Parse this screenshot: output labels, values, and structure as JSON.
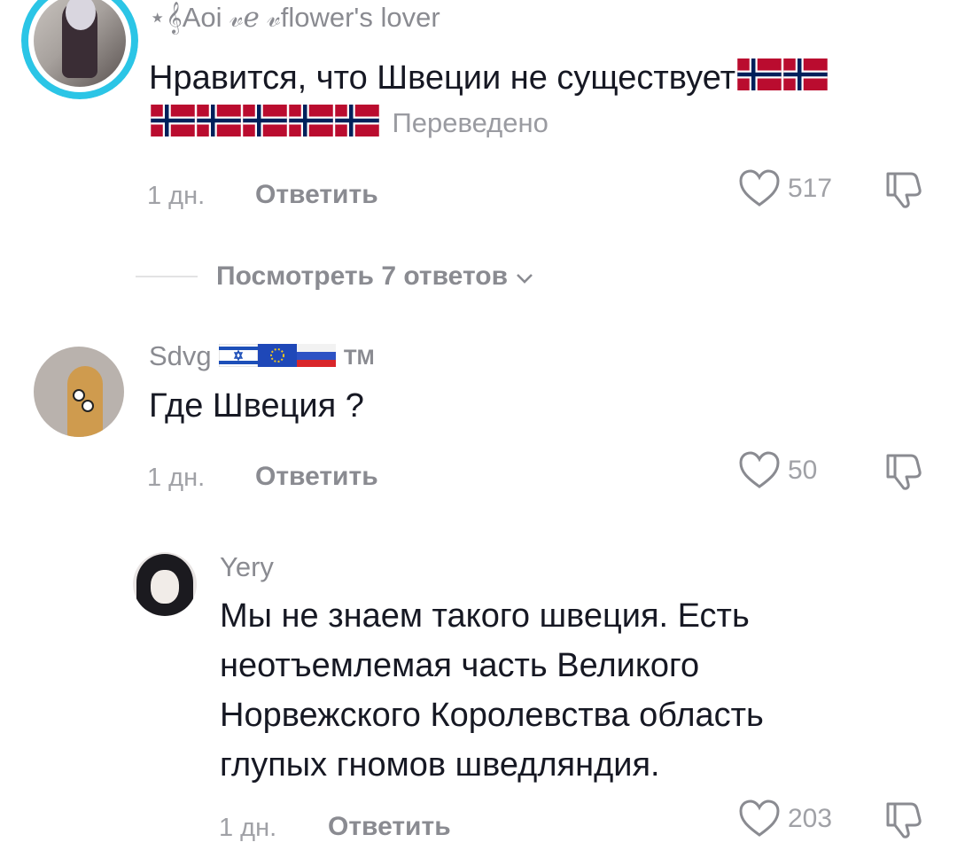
{
  "comments": [
    {
      "username": "⋆𝄞Aoi 𝓋ℯ 𝓋flower's lover",
      "text": "Нравится, что Швеции не существует",
      "translated_label": "Переведено",
      "time": "1 дн.",
      "reply_label": "Ответить",
      "likes": "517",
      "flags_line1": 2,
      "flags_line2": 5
    },
    {
      "username": "Sdvg",
      "username_suffix": "TM",
      "text": "Где Швеция ?",
      "time": "1 дн.",
      "reply_label": "Ответить",
      "likes": "50"
    },
    {
      "username": "Yery",
      "text_lines": [
        "Мы не знаем такого швеция. Есть",
        "неотъемлемая часть Великого",
        "Норвежского Королевства область",
        "глупых гномов шведляндия."
      ],
      "time": "1 дн.",
      "reply_label": "Ответить",
      "likes": "203"
    }
  ],
  "view_replies_label": "Посмотреть 7 ответов",
  "colors": {
    "avatar_ring": "#2bc5e6",
    "norway_red": "#ba0c2f",
    "norway_blue": "#00205b"
  }
}
